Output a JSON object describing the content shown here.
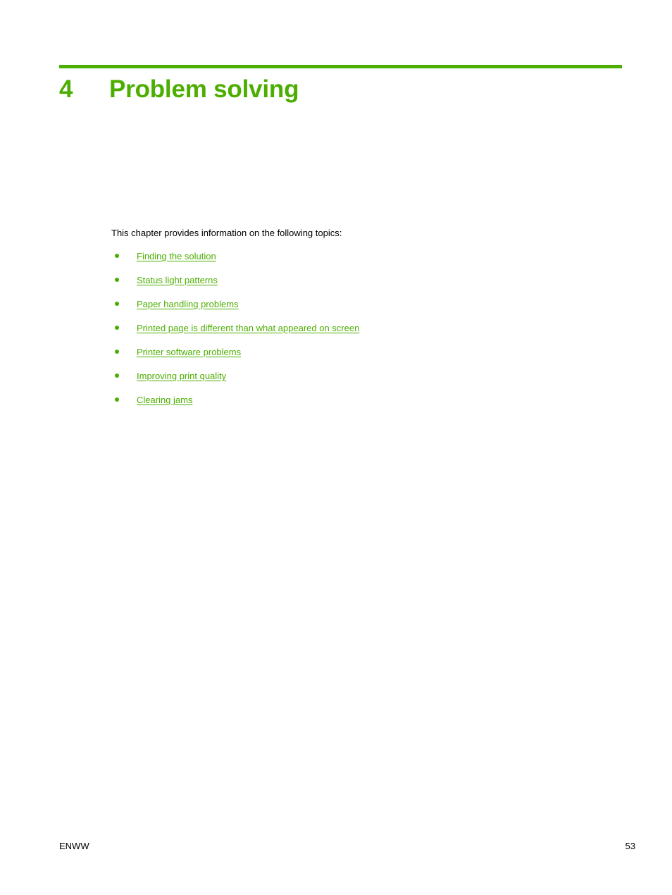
{
  "theme": {
    "accent_green": "#4CAE00",
    "text_black": "#000000",
    "page_background": "#ffffff"
  },
  "chapter": {
    "number": "4",
    "title": "Problem solving",
    "rule_icon": "horizontal-rule"
  },
  "body": {
    "intro": "This chapter provides information on the following topics:",
    "topics": [
      {
        "label": "Finding the solution"
      },
      {
        "label": "Status light patterns"
      },
      {
        "label": "Paper handling problems"
      },
      {
        "label": "Printed page is different than what appeared on screen"
      },
      {
        "label": "Printer software problems"
      },
      {
        "label": "Improving print quality"
      },
      {
        "label": "Clearing jams"
      }
    ]
  },
  "footer": {
    "left_label": "ENWW",
    "page_number": "53"
  }
}
